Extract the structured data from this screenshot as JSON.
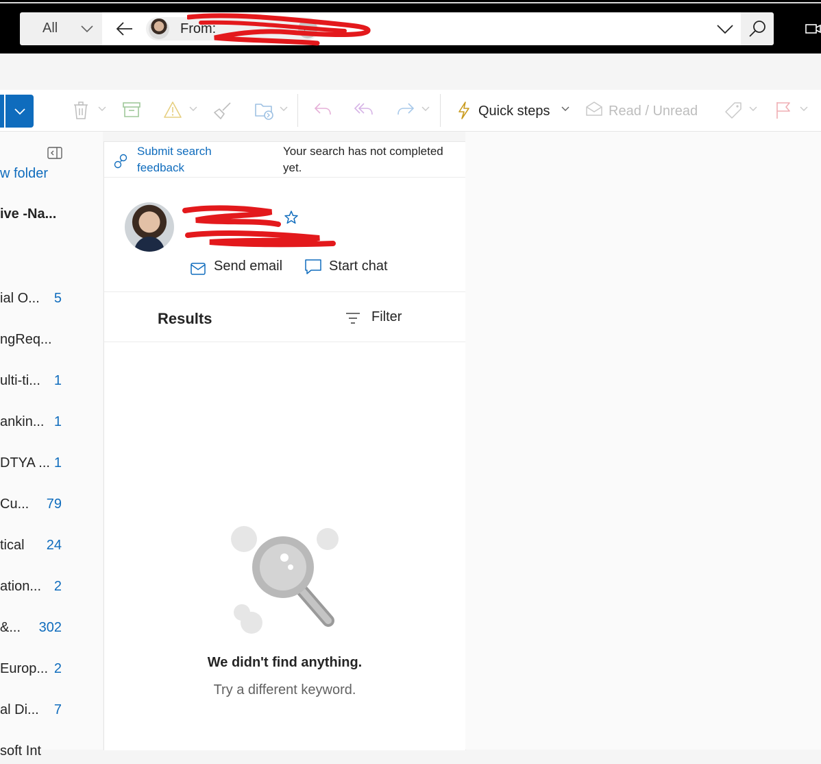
{
  "search": {
    "scope": "All",
    "chip_label": "From:"
  },
  "ribbon": {
    "quick_steps": "Quick steps",
    "read_unread": "Read / Unread"
  },
  "folders": {
    "new_folder": "w folder",
    "account": "ive -Na...",
    "items": [
      {
        "name": "ial O...",
        "count": "5"
      },
      {
        "name": "ngReq...",
        "count": ""
      },
      {
        "name": "ulti-ti...",
        "count": "1"
      },
      {
        "name": "ankin...",
        "count": "1"
      },
      {
        "name": "DTYA ...",
        "count": "1"
      },
      {
        "name": " Cu...",
        "count": "79"
      },
      {
        "name": "tical",
        "count": "24"
      },
      {
        "name": "ation...",
        "count": "2"
      },
      {
        "name": " &...",
        "count": "302"
      },
      {
        "name": "Europ...",
        "count": "2"
      },
      {
        "name": "al Di...",
        "count": "7"
      },
      {
        "name": "soft Int",
        "count": ""
      }
    ]
  },
  "feedback": {
    "link": "Submit search feedback",
    "status": "Your search has not completed yet."
  },
  "person": {
    "send_email": "Send email",
    "start_chat": "Start chat"
  },
  "results": {
    "title": "Results",
    "filter": "Filter"
  },
  "empty": {
    "title": "We didn't find anything.",
    "subtitle": "Try a different keyword."
  },
  "colors": {
    "accent": "#0f6cbd",
    "redaction": "#e3191c"
  }
}
